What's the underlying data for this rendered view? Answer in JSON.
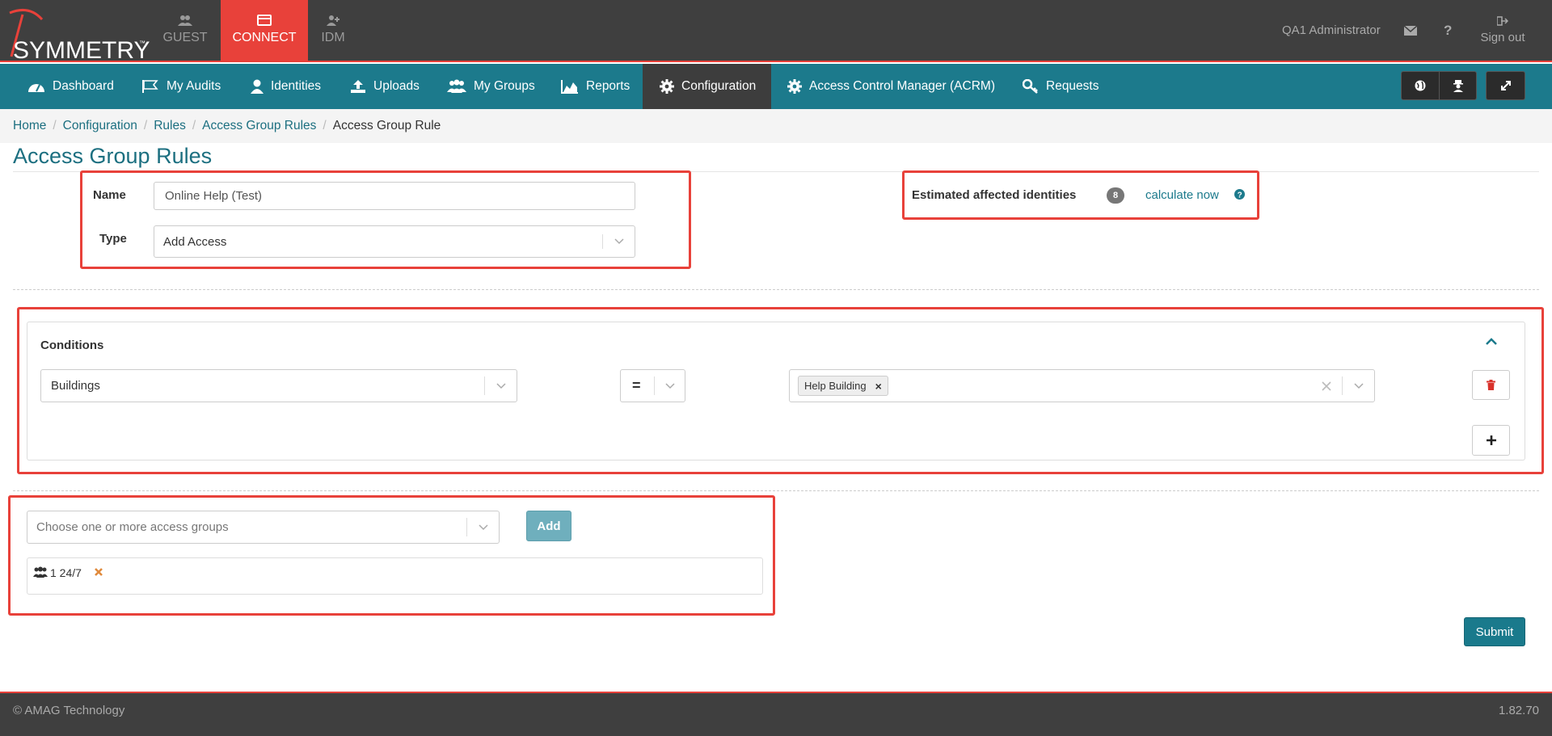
{
  "brand": {
    "name": "SYMMETRY",
    "trademark": "™"
  },
  "app_tabs": [
    {
      "label": "GUEST",
      "icon": "users-icon"
    },
    {
      "label": "CONNECT",
      "icon": "card-icon"
    },
    {
      "label": "IDM",
      "icon": "user-plus-icon"
    }
  ],
  "user": {
    "name": "QA1 Administrator",
    "signout_label": "Sign out"
  },
  "nav": [
    {
      "label": "Dashboard",
      "icon": "dashboard-icon"
    },
    {
      "label": "My Audits",
      "icon": "flag-icon"
    },
    {
      "label": "Identities",
      "icon": "user-icon"
    },
    {
      "label": "Uploads",
      "icon": "upload-icon"
    },
    {
      "label": "My Groups",
      "icon": "group-icon"
    },
    {
      "label": "Reports",
      "icon": "area-chart-icon"
    },
    {
      "label": "Configuration",
      "icon": "gear-icon"
    },
    {
      "label": "Access Control Manager (ACRM)",
      "icon": "gear-icon"
    },
    {
      "label": "Requests",
      "icon": "key-icon"
    }
  ],
  "breadcrumb": [
    "Home",
    "Configuration",
    "Rules",
    "Access Group Rules",
    "Access Group Rule"
  ],
  "page_title": "Access Group Rules",
  "form": {
    "name_label": "Name",
    "name_value": "Online Help (Test)",
    "type_label": "Type",
    "type_value": "Add Access"
  },
  "estimate": {
    "label": "Estimated affected identities",
    "count": "8",
    "link": "calculate now"
  },
  "conditions": {
    "title": "Conditions",
    "field": "Buildings",
    "operator": "=",
    "value_chip": "Help Building",
    "chip_remove": "×"
  },
  "access_groups": {
    "placeholder": "Choose one or more access groups",
    "add_label": "Add",
    "selected": "1 24/7"
  },
  "submit_label": "Submit",
  "footer": {
    "copyright": "© AMAG Technology",
    "version": "1.82.70"
  },
  "colors": {
    "accent_red": "#e8413a",
    "teal": "#1c7a8c",
    "dark": "#3f3f3f"
  }
}
